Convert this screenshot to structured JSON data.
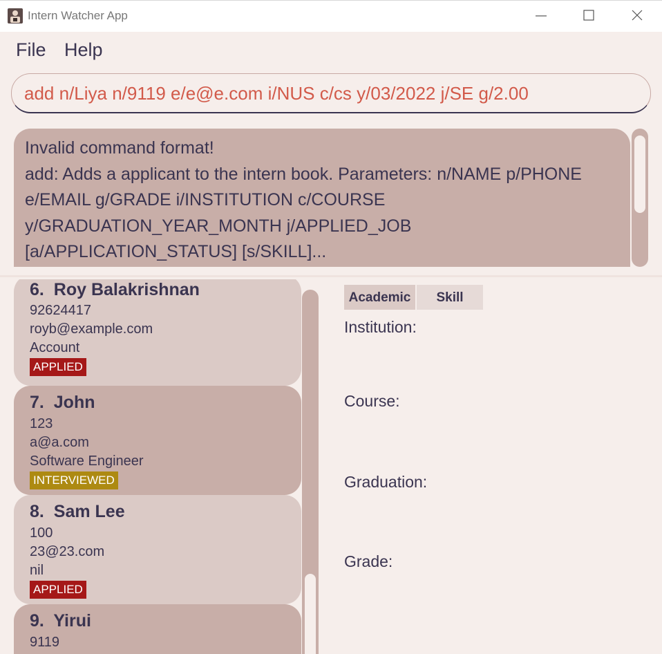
{
  "window": {
    "title": "Intern Watcher App",
    "icon": "person-icon"
  },
  "menu": {
    "items": [
      "File",
      "Help"
    ]
  },
  "command": {
    "value": "add n/Liya n/9119 e/e@e.com i/NUS c/cs y/03/2022 j/SE g/2.00"
  },
  "result": {
    "text": "Invalid command format!\nadd: Adds a applicant to the intern book. Parameters: n/NAME p/PHONE e/EMAIL g/GRADE i/INSTITUTION c/COURSE y/GRADUATION_YEAR_MONTH j/APPLIED_JOB [a/APPLICATION_STATUS] [s/SKILL]..."
  },
  "applicants": [
    {
      "index": "6.",
      "name": "Roy Balakrishnan",
      "phone": "92624417",
      "email": "royb@example.com",
      "job": "Account",
      "status": "APPLIED"
    },
    {
      "index": "7.",
      "name": "John",
      "phone": "123",
      "email": "a@a.com",
      "job": "Software Engineer",
      "status": "INTERVIEWED"
    },
    {
      "index": "8.",
      "name": "Sam Lee",
      "phone": "100",
      "email": "23@23.com",
      "job": "nil",
      "status": "APPLIED"
    },
    {
      "index": "9.",
      "name": "Yirui",
      "phone": "9119"
    }
  ],
  "details": {
    "tabs": [
      "Academic",
      "Skill"
    ],
    "labels": {
      "institution": "Institution:",
      "course": "Course:",
      "graduation": "Graduation:",
      "grade": "Grade:"
    }
  },
  "colors": {
    "applied": "#a51818",
    "interviewed": "#ad8a12",
    "command_text": "#d25a4a",
    "card_light": "#dbcac6",
    "card_dark": "#c8aea8"
  }
}
